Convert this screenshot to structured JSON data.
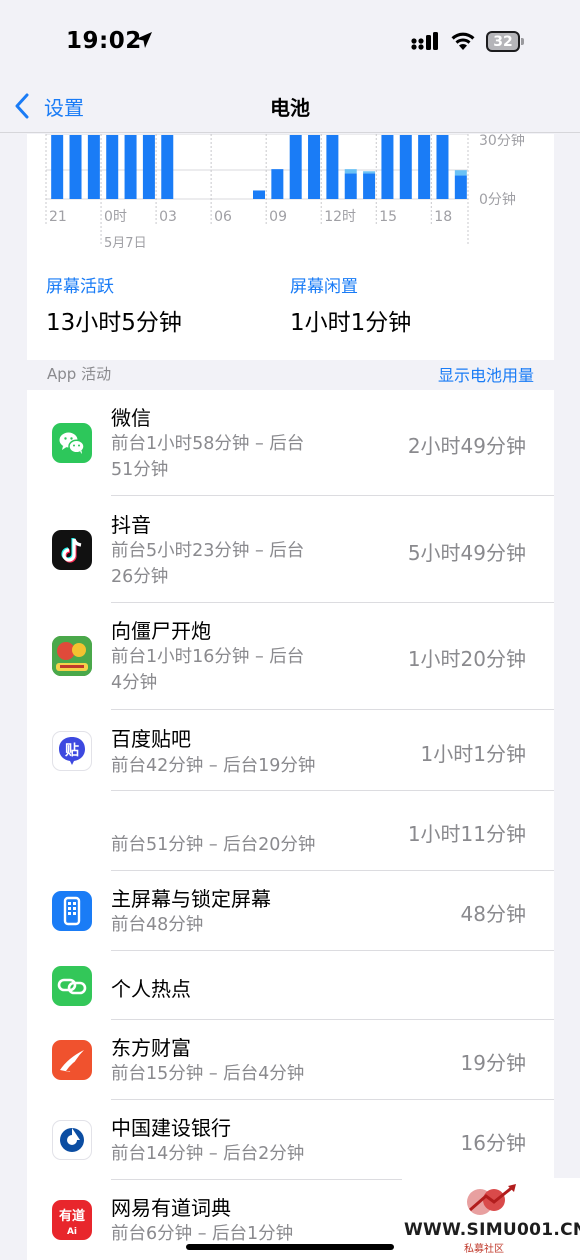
{
  "status_bar": {
    "time": "19:02",
    "battery": "32"
  },
  "nav": {
    "back_label": "设置",
    "title": "电池"
  },
  "chart_data": {
    "type": "bar",
    "categories": [
      "21",
      "0时",
      "03",
      "06",
      "09",
      "12时",
      "15",
      "18"
    ],
    "sub_label": "5月7日",
    "y_ticks": [
      "30分钟",
      "0分钟"
    ],
    "series": [
      {
        "values": [
          60,
          60,
          60,
          60,
          60,
          60,
          60,
          0,
          0,
          0,
          0,
          8,
          28,
          60,
          60,
          60,
          24,
          24,
          60,
          60,
          60,
          60,
          22
        ]
      },
      {
        "values": [
          0,
          0,
          0,
          0,
          0,
          0,
          0,
          0,
          0,
          0,
          0,
          0,
          0,
          0,
          0,
          0,
          4,
          2,
          0,
          0,
          0,
          0,
          5
        ]
      }
    ],
    "colors": {
      "screen_on": "#1a7cf6",
      "screen_off": "#6ac1f5"
    }
  },
  "stats": {
    "active_label": "屏幕活跃",
    "active_value": "13小时5分钟",
    "idle_label": "屏幕闲置",
    "idle_value": "1小时1分钟"
  },
  "section": {
    "title": "App 活动",
    "link": "显示电池用量"
  },
  "apps": [
    {
      "name": "微信",
      "detail1": "前台1小时58分钟 – 后台",
      "detail2": "51分钟",
      "total": "2小时49分钟",
      "icon": "wechat-icon"
    },
    {
      "name": "抖音",
      "detail1": "前台5小时23分钟 – 后台",
      "detail2": "26分钟",
      "total": "5小时49分钟",
      "icon": "douyin-icon"
    },
    {
      "name": "向僵尸开炮",
      "detail1": "前台1小时16分钟 – 后台",
      "detail2": "4分钟",
      "total": "1小时20分钟",
      "icon": "zombie-game-icon"
    },
    {
      "name": "百度贴吧",
      "detail1": "前台42分钟 – 后台19分钟",
      "detail2": "",
      "total": "1小时1分钟",
      "icon": "tieba-icon"
    },
    {
      "name": "",
      "detail1": "前台51分钟 – 后台20分钟",
      "detail2": "",
      "total": "1小时11分钟",
      "icon": ""
    },
    {
      "name": "主屏幕与锁定屏幕",
      "detail1": "前台48分钟",
      "detail2": "",
      "total": "48分钟",
      "icon": "home-screen-icon"
    },
    {
      "name": "个人热点",
      "detail1": "",
      "detail2": "",
      "total": "",
      "icon": "hotspot-icon"
    },
    {
      "name": "东方财富",
      "detail1": "前台15分钟 – 后台4分钟",
      "detail2": "",
      "total": "19分钟",
      "icon": "eastmoney-icon"
    },
    {
      "name": "中国建设银行",
      "detail1": "前台14分钟 – 后台2分钟",
      "detail2": "",
      "total": "16分钟",
      "icon": "ccb-icon"
    },
    {
      "name": "网易有道词典",
      "detail1": "前台6分钟 – 后台1分钟",
      "detail2": "",
      "total": "",
      "icon": "youdao-icon"
    }
  ],
  "icon_text": {
    "tieba": "贴",
    "youdao_top": "有道",
    "youdao_bottom": "Ai"
  },
  "watermark": {
    "text": "WWW.SIMU001.CN",
    "sub": "私募社区"
  }
}
